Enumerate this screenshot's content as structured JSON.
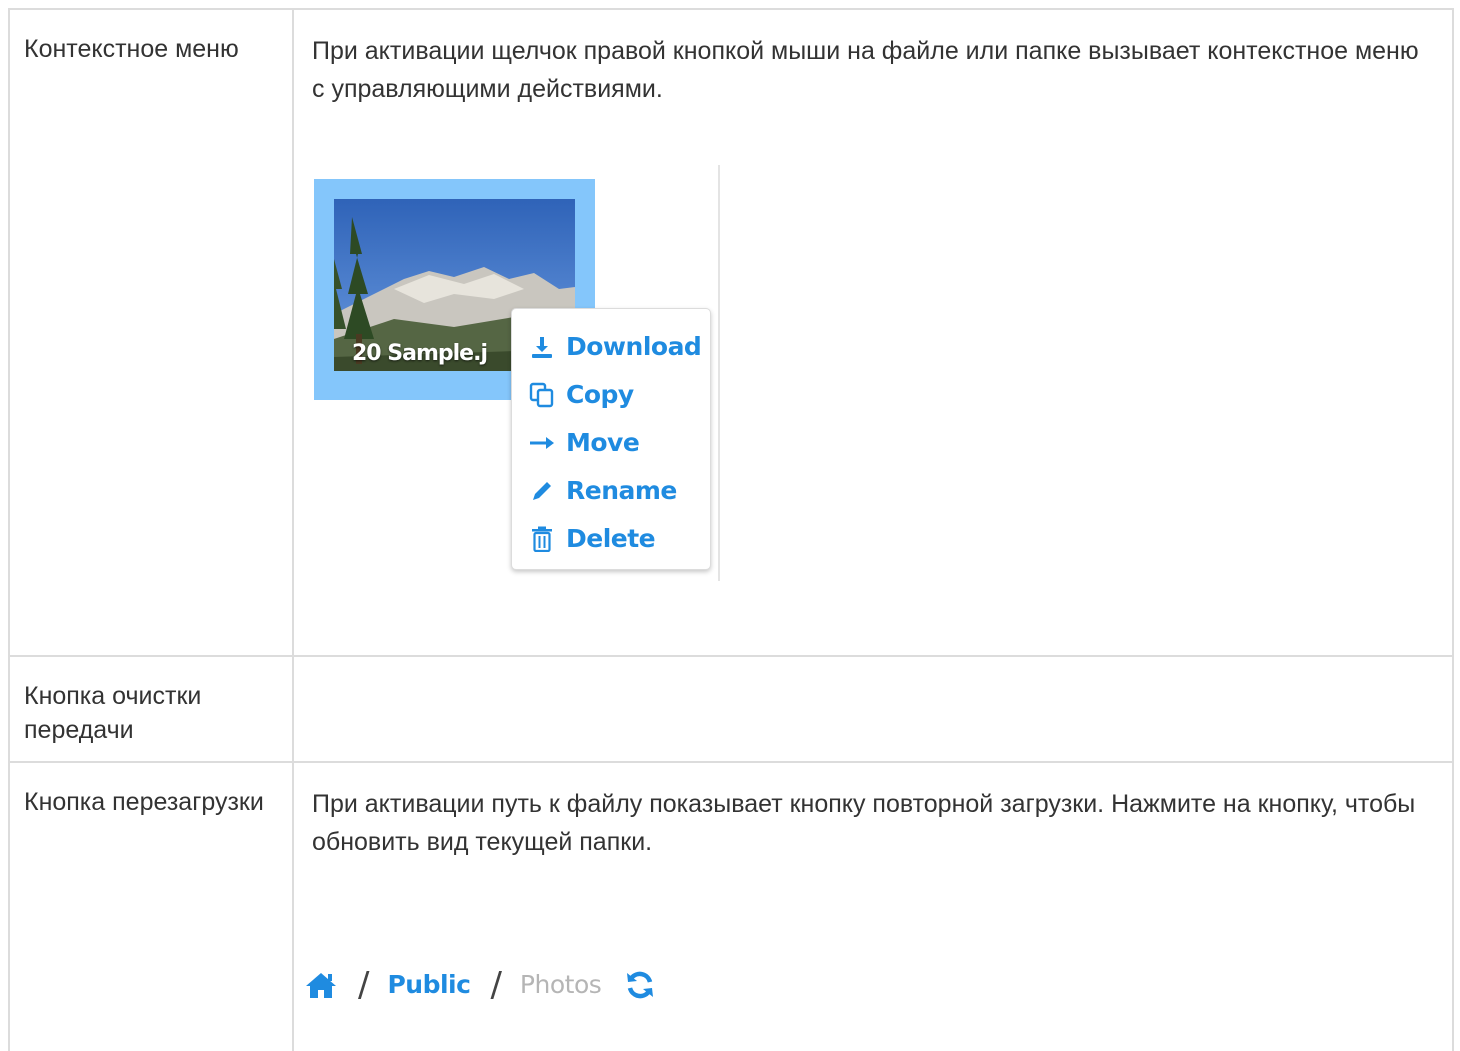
{
  "rows": [
    {
      "term": "Контекстное меню",
      "description": "При активации щелчок правой кнопкой мыши на файле или папке вызывает контекстное меню с управляющими действиями."
    },
    {
      "term": "Кнопка очистки передачи",
      "description": ""
    },
    {
      "term": "Кнопка перезагрузки",
      "description": "При активации путь к файлу показывает кнопку повторной загрузки. Нажмите на кнопку, чтобы обновить вид текущей папки."
    }
  ],
  "context_figure": {
    "file_name": "20 Sample.j",
    "menu": [
      {
        "label": "Download",
        "icon": "download-icon"
      },
      {
        "label": "Copy",
        "icon": "copy-icon"
      },
      {
        "label": "Move",
        "icon": "arrow-right-icon"
      },
      {
        "label": "Rename",
        "icon": "pencil-icon"
      },
      {
        "label": "Delete",
        "icon": "trash-icon"
      }
    ],
    "colors": {
      "accent": "#1f8be0",
      "selection": "#84c6fb"
    }
  },
  "breadcrumb_figure": {
    "home_icon": "home-icon",
    "items": [
      "Public",
      "Photos"
    ],
    "reload_icon": "refresh-icon",
    "colors": {
      "link": "#1f8be0",
      "current": "#b5b5b5"
    }
  }
}
